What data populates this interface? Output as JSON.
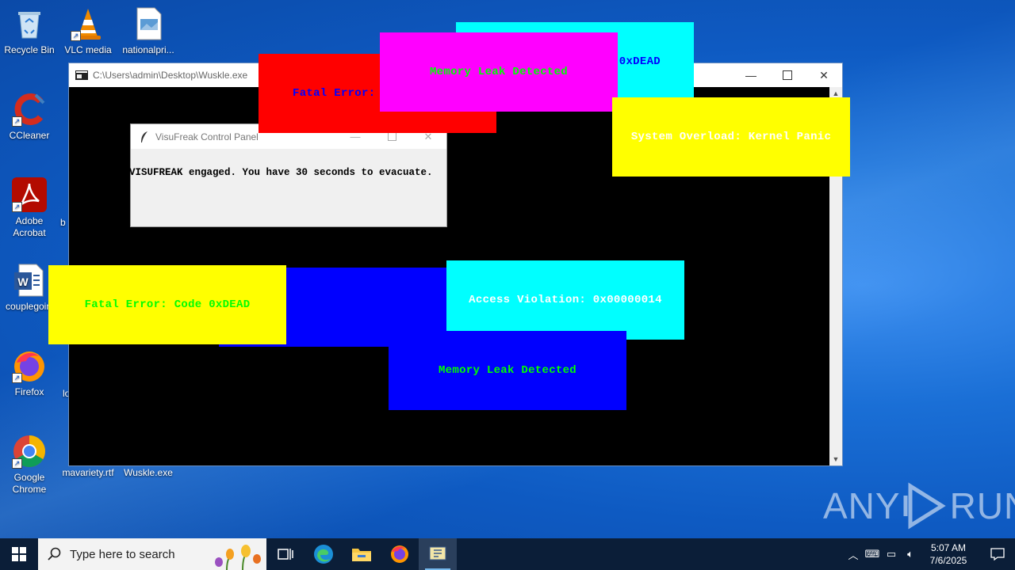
{
  "desktop": {
    "icons": [
      {
        "label": "Recycle Bin"
      },
      {
        "label": "VLC media"
      },
      {
        "label": "nationalpri..."
      },
      {
        "label": "CCleaner"
      },
      {
        "label": "Adobe Acrobat"
      },
      {
        "label": "b"
      },
      {
        "label": "couplegoin"
      },
      {
        "label": "Firefox"
      },
      {
        "label": "lo"
      },
      {
        "label": "Google Chrome"
      },
      {
        "label": "mavariety.rtf"
      },
      {
        "label": "Wuskle.exe"
      }
    ]
  },
  "console_window": {
    "title": "C:\\Users\\admin\\Desktop\\Wuskle.exe"
  },
  "dialog": {
    "title": "VisuFreak Control Panel",
    "message": "VISUFREAK engaged. You have 30 seconds to evacuate."
  },
  "popups": [
    {
      "text": "0xDEAD",
      "bg": "#00ffff",
      "fg": "#0000ff"
    },
    {
      "text": "Fatal Error: ",
      "bg": "#ff0000",
      "fg": "#0000ff"
    },
    {
      "text": "Memory Leak Detected",
      "bg": "#ff00ff",
      "fg": "#00ff00"
    },
    {
      "text": "System Overload: Kernel Panic",
      "bg": "#ffff00",
      "fg": "#ffffff"
    },
    {
      "text": "",
      "bg": "#0000ff",
      "fg": "#0000ff"
    },
    {
      "text": "Fatal Error: Code 0xDEAD",
      "bg": "#ffff00",
      "fg": "#00ff00"
    },
    {
      "text": "Access Violation: 0x00000014",
      "bg": "#00ffff",
      "fg": "#ffffff"
    },
    {
      "text": "Memory Leak Detected",
      "bg": "#0000ff",
      "fg": "#00ff00"
    }
  ],
  "taskbar": {
    "search_placeholder": "Type here to search",
    "time": "5:07 AM",
    "date": "7/6/2025"
  },
  "watermark": {
    "text_left": "ANY",
    "text_right": "RUN"
  }
}
